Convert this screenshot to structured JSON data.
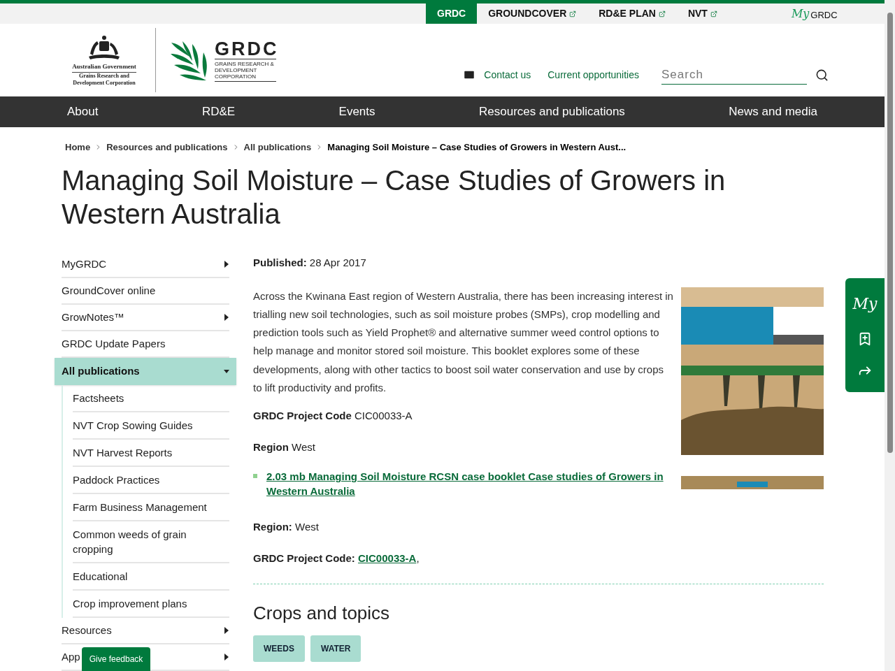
{
  "top_tabs": [
    {
      "label": "GRDC",
      "selected": true,
      "external": false
    },
    {
      "label": "GROUNDCOVER",
      "selected": false,
      "external": true
    },
    {
      "label": "RD&E PLAN",
      "selected": false,
      "external": true
    },
    {
      "label": "NVT",
      "selected": false,
      "external": true
    }
  ],
  "mygrdc": {
    "prefix": "My",
    "label": "GRDC"
  },
  "gov_logo": {
    "title": "Australian Government",
    "subtitle": "Grains Research and Development Corporation"
  },
  "grdc_logo": {
    "wordmark": "GRDC",
    "tagline": "GRAINS RESEARCH & DEVELOPMENT CORPORATION"
  },
  "utility_links": [
    "Contact us",
    "Current opportunities"
  ],
  "search": {
    "placeholder": "Search"
  },
  "main_nav": [
    "About",
    "RD&E",
    "Events",
    "Resources and publications",
    "News and media"
  ],
  "breadcrumb": [
    "Home",
    "Resources and publications",
    "All publications",
    "Managing Soil Moisture – Case Studies of Growers in Western Aust..."
  ],
  "title": "Managing Soil Moisture – Case Studies of Growers in Western Australia",
  "sidebar": [
    {
      "label": "MyGRDC",
      "selected": false,
      "submenu": true,
      "expanded": false
    },
    {
      "label": "GroundCover online",
      "selected": false,
      "submenu": false,
      "expanded": false
    },
    {
      "label": "GrowNotes™",
      "selected": false,
      "submenu": true,
      "expanded": false
    },
    {
      "label": "GRDC Update Papers",
      "selected": false,
      "submenu": false,
      "expanded": false
    },
    {
      "label": "All publications",
      "selected": true,
      "submenu": true,
      "expanded": true,
      "children": [
        {
          "label": "Factsheets"
        },
        {
          "label": "NVT Crop Sowing Guides"
        },
        {
          "label": "NVT Harvest Reports"
        },
        {
          "label": "Paddock Practices"
        },
        {
          "label": "Farm Business Management"
        },
        {
          "label": "Common weeds of grain cropping"
        },
        {
          "label": "Educational"
        },
        {
          "label": "Crop improvement plans"
        }
      ]
    },
    {
      "label": "Resources",
      "selected": false,
      "submenu": true,
      "expanded": false
    },
    {
      "label": "App",
      "selected": false,
      "submenu": true,
      "expanded": false
    }
  ],
  "published": {
    "label": "Published:",
    "value": "28 Apr 2017"
  },
  "description": "Across the Kwinana East region of Western Australia, there has been increasing interest in trialling new soil technologies, such as soil moisture probes (SMPs), crop modelling and prediction tools such as Yield Prophet® and alternative summer weed control options to help manage and monitor stored soil moisture. This booklet explores some of these developments, along with other tactics to boost soil water conservation and use by crops to lift productivity and profits.",
  "project_code": {
    "label": "GRDC Project Code",
    "value": "CIC00033-A"
  },
  "region": {
    "label": "Region",
    "value": "West"
  },
  "download": "2.03 mb Managing Soil Moisture RCSN case booklet Case studies of Growers in Western Australia",
  "cover": {
    "kind": "picture"
  },
  "region_2": {
    "label": "Region:",
    "value": "West"
  },
  "project_code_2": {
    "label": "GRDC Project Code:",
    "value": "CIC00033-A",
    "suffix": ","
  },
  "section_title": "Crops and topics",
  "tags": [
    "WEEDS",
    "WATER"
  ],
  "side_tools": {
    "my_label": "My"
  },
  "feedback": "Give feedback"
}
